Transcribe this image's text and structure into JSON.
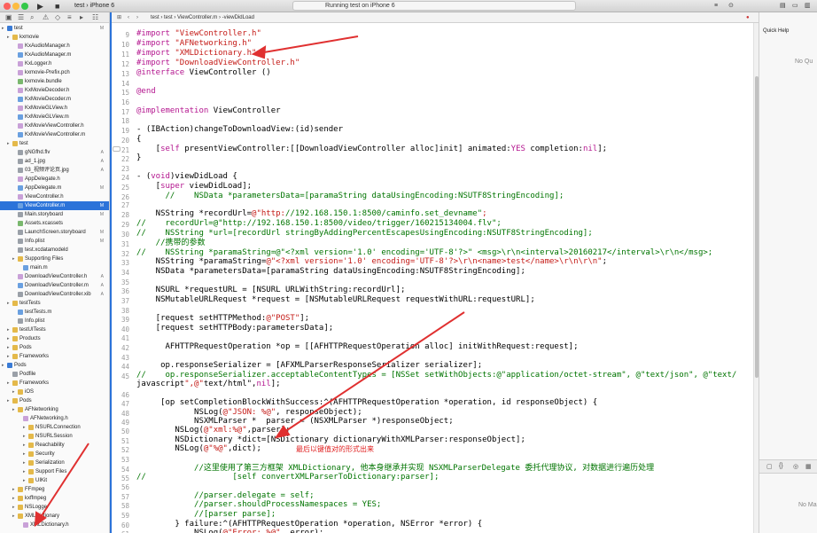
{
  "toolbar": {
    "run_icon": "play-icon",
    "stop_icon": "stop-icon",
    "scheme": "test",
    "device": "iPhone 6",
    "status_text": "Running test on iPhone 6"
  },
  "jumpbar": {
    "crumbs": [
      "test",
      "test",
      "ViewController.m",
      "-viewDidLoad"
    ]
  },
  "navigator": {
    "rows": [
      {
        "label": "test",
        "badge": "M",
        "kind": "project"
      },
      {
        "label": "kxmovie",
        "badge": "",
        "kind": "folder"
      },
      {
        "label": "KxAudioManager.h",
        "badge": "",
        "kind": "h"
      },
      {
        "label": "KxAudioManager.m",
        "badge": "",
        "kind": "m"
      },
      {
        "label": "KxLogger.h",
        "badge": "",
        "kind": "h"
      },
      {
        "label": "kxmovie-Prefix.pch",
        "badge": "",
        "kind": "h"
      },
      {
        "label": "kxmovie.bundle",
        "badge": "",
        "kind": "bundle"
      },
      {
        "label": "KxMovieDecoder.h",
        "badge": "",
        "kind": "h"
      },
      {
        "label": "KxMovieDecoder.m",
        "badge": "",
        "kind": "m"
      },
      {
        "label": "KxMovieGLView.h",
        "badge": "",
        "kind": "h"
      },
      {
        "label": "KxMovieGLView.m",
        "badge": "",
        "kind": "m"
      },
      {
        "label": "KxMovieViewController.h",
        "badge": "",
        "kind": "h"
      },
      {
        "label": "KxMovieViewController.m",
        "badge": "",
        "kind": "m"
      },
      {
        "label": "test",
        "badge": "",
        "kind": "folder"
      },
      {
        "label": "gNGfhd.flv",
        "badge": "A",
        "kind": "file"
      },
      {
        "label": "ad_1.jpg",
        "badge": "A",
        "kind": "file"
      },
      {
        "label": "03_视频评论页.jpg",
        "badge": "A",
        "kind": "file"
      },
      {
        "label": "AppDelegate.h",
        "badge": "",
        "kind": "h"
      },
      {
        "label": "AppDelegate.m",
        "badge": "M",
        "kind": "m"
      },
      {
        "label": "ViewController.h",
        "badge": "",
        "kind": "h"
      },
      {
        "label": "ViewController.m",
        "badge": "M",
        "kind": "m"
      },
      {
        "label": "Main.storyboard",
        "badge": "M",
        "kind": "file"
      },
      {
        "label": "Assets.xcassets",
        "badge": "",
        "kind": "bundle"
      },
      {
        "label": "LaunchScreen.storyboard",
        "badge": "M",
        "kind": "file"
      },
      {
        "label": "Info.plist",
        "badge": "M",
        "kind": "file"
      },
      {
        "label": "test.xcdatamodeld",
        "badge": "",
        "kind": "file"
      },
      {
        "label": "Supporting Files",
        "badge": "",
        "kind": "folder"
      },
      {
        "label": "main.m",
        "badge": "",
        "kind": "m"
      },
      {
        "label": "DownloadViewController.h",
        "badge": "A",
        "kind": "h"
      },
      {
        "label": "DownloadViewController.m",
        "badge": "A",
        "kind": "m"
      },
      {
        "label": "DownloadViewController.xib",
        "badge": "A",
        "kind": "file"
      },
      {
        "label": "testTests",
        "badge": "",
        "kind": "folder"
      },
      {
        "label": "testTests.m",
        "badge": "",
        "kind": "m"
      },
      {
        "label": "Info.plist",
        "badge": "",
        "kind": "file"
      },
      {
        "label": "testUITests",
        "badge": "",
        "kind": "folder"
      },
      {
        "label": "Products",
        "badge": "",
        "kind": "folder"
      },
      {
        "label": "Pods",
        "badge": "",
        "kind": "folder"
      },
      {
        "label": "Frameworks",
        "badge": "",
        "kind": "folder"
      },
      {
        "label": "Pods",
        "badge": "",
        "kind": "project"
      },
      {
        "label": "Podfile",
        "badge": "",
        "kind": "file"
      },
      {
        "label": "Frameworks",
        "badge": "",
        "kind": "folder"
      },
      {
        "label": "iOS",
        "badge": "",
        "kind": "folder"
      },
      {
        "label": "Pods",
        "badge": "",
        "kind": "folder"
      },
      {
        "label": "AFNetworking",
        "badge": "",
        "kind": "folder"
      },
      {
        "label": "AFNetworking.h",
        "badge": "",
        "kind": "h"
      },
      {
        "label": "NSURLConnection",
        "badge": "",
        "kind": "folder"
      },
      {
        "label": "NSURLSession",
        "badge": "",
        "kind": "folder"
      },
      {
        "label": "Reachability",
        "badge": "",
        "kind": "folder"
      },
      {
        "label": "Security",
        "badge": "",
        "kind": "folder"
      },
      {
        "label": "Serialization",
        "badge": "",
        "kind": "folder"
      },
      {
        "label": "Support Files",
        "badge": "",
        "kind": "folder"
      },
      {
        "label": "UIKit",
        "badge": "",
        "kind": "folder"
      },
      {
        "label": "FFmpeg",
        "badge": "",
        "kind": "folder"
      },
      {
        "label": "kxffmpeg",
        "badge": "",
        "kind": "folder"
      },
      {
        "label": "NSLogger",
        "badge": "",
        "kind": "folder"
      },
      {
        "label": "XMLDictionary",
        "badge": "",
        "kind": "folder"
      },
      {
        "label": "XMLDictionary.h",
        "badge": "",
        "kind": "h"
      }
    ]
  },
  "editor": {
    "lines": [
      {
        "n": "9",
        "t": "#import \"ViewController.h\""
      },
      {
        "n": "10",
        "t": "#import \"AFNetworking.h\""
      },
      {
        "n": "11",
        "t": "#import \"XMLDictionary.h\""
      },
      {
        "n": "12",
        "t": "#import \"DownloadViewController.h\""
      },
      {
        "n": "13",
        "t": "@interface ViewController ()"
      },
      {
        "n": "14",
        "t": ""
      },
      {
        "n": "15",
        "t": "@end"
      },
      {
        "n": "16",
        "t": ""
      },
      {
        "n": "17",
        "t": "@implementation ViewController"
      },
      {
        "n": "18",
        "t": ""
      },
      {
        "n": "19",
        "t": "- (IBAction)changeToDownloadView:(id)sender"
      },
      {
        "n": "20",
        "t": "{"
      },
      {
        "n": "21",
        "t": "    [self presentViewController:[[DownloadViewController alloc]init] animated:YES completion:nil];"
      },
      {
        "n": "22",
        "t": "}"
      },
      {
        "n": "23",
        "t": ""
      },
      {
        "n": "24",
        "t": "- (void)viewDidLoad {"
      },
      {
        "n": "25",
        "t": "    [super viewDidLoad];"
      },
      {
        "n": "26",
        "t": "      //    NSData *parametersData=[paramaString dataUsingEncoding:NSUTF8StringEncoding];"
      },
      {
        "n": "27",
        "t": ""
      },
      {
        "n": "28",
        "t": "    NSString *recordUrl=@\"http://192.168.150.1:8500/caminfo.set_devname\";"
      },
      {
        "n": "29",
        "t": "//    recordUrl=@\"http://192.168.150.1:8500/video/trigger/160215134004.flv\";"
      },
      {
        "n": "30",
        "t": "//    NSString *url=[recordUrl stringByAddingPercentEscapesUsingEncoding:NSUTF8StringEncoding];"
      },
      {
        "n": "31",
        "t": "    //携带的参数"
      },
      {
        "n": "32",
        "t": "//    NSString *paramaString=@\"<?xml version='1.0' encoding='UTF-8'?>\" <msg>\\r\\n<interval>20160217</interval>\\r\\n</msg>;"
      },
      {
        "n": "33",
        "t": "    NSString *paramaString=@\"<?xml version='1.0' encoding='UTF-8'?>\\r\\n<name>test</name>\\r\\n\\r\\n\";"
      },
      {
        "n": "34",
        "t": "    NSData *parametersData=[paramaString dataUsingEncoding:NSUTF8StringEncoding];"
      },
      {
        "n": "35",
        "t": ""
      },
      {
        "n": "36",
        "t": "    NSURL *requestURL = [NSURL URLWithString:recordUrl];"
      },
      {
        "n": "37",
        "t": "    NSMutableURLRequest *request = [NSMutableURLRequest requestWithURL:requestURL];"
      },
      {
        "n": "38",
        "t": ""
      },
      {
        "n": "39",
        "t": "    [request setHTTPMethod:@\"POST\"];"
      },
      {
        "n": "40",
        "t": "    [request setHTTPBody:parametersData];"
      },
      {
        "n": "41",
        "t": ""
      },
      {
        "n": "42",
        "t": "      AFHTTPRequestOperation *op = [[AFHTTPRequestOperation alloc] initWithRequest:request];"
      },
      {
        "n": "43",
        "t": ""
      },
      {
        "n": "44",
        "t": "     op.responseSerializer = [AFXMLParserResponseSerializer serializer];"
      },
      {
        "n": "45",
        "t": "//    op.responseSerializer.acceptableContentTypes = [NSSet setWithObjects:@\"application/octet-stream\", @\"text/json\", @\"text/"
      },
      {
        "n": "",
        "t": "javascript\",@\"text/html\",nil];"
      },
      {
        "n": "46",
        "t": ""
      },
      {
        "n": "47",
        "t": "     [op setCompletionBlockWithSuccess:^(AFHTTPRequestOperation *operation, id responseObject) {"
      },
      {
        "n": "48",
        "t": "            NSLog(@\"JSON: %@\", responseObject);"
      },
      {
        "n": "49",
        "t": "            NSXMLParser *  parser = (NSXMLParser *)responseObject;"
      },
      {
        "n": "50",
        "t": "        NSLog(@\"xml:%@\",parser);"
      },
      {
        "n": "51",
        "t": "        NSDictionary *dict=[NSDictionary dictionaryWithXMLParser:responseObject];"
      },
      {
        "n": "52",
        "t": "        NSLog(@\"%@\",dict);"
      },
      {
        "n": "53",
        "t": ""
      },
      {
        "n": "54",
        "t": "            //这里使用了第三方框架 XMLDictionary, 他本身继承并实现 NSXMLParserDelegate 委托代理协议, 对数据进行遍历处理"
      },
      {
        "n": "55",
        "t": "//                  [self convertXMLParserToDictionary:parser];"
      },
      {
        "n": "56",
        "t": ""
      },
      {
        "n": "57",
        "t": "            //parser.delegate = self;"
      },
      {
        "n": "58",
        "t": "            //parser.shouldProcessNamespaces = YES;"
      },
      {
        "n": "59",
        "t": "            //[parser parse];"
      },
      {
        "n": "60",
        "t": "        } failure:^(AFHTTPRequestOperation *operation, NSError *error) {"
      },
      {
        "n": "61",
        "t": "            NSLog(@\"Error: %@\", error);"
      }
    ],
    "annotation": "最后以键值对的形式出来"
  },
  "inspector": {
    "title": "Quick Help",
    "empty_top": "No Qu",
    "empty_bottom": "No Ma"
  },
  "colors": {
    "selection": "#2b73d9",
    "keyword": "#b4168f",
    "string": "#c41a16",
    "comment": "#007400",
    "annotation": "#e02020"
  }
}
